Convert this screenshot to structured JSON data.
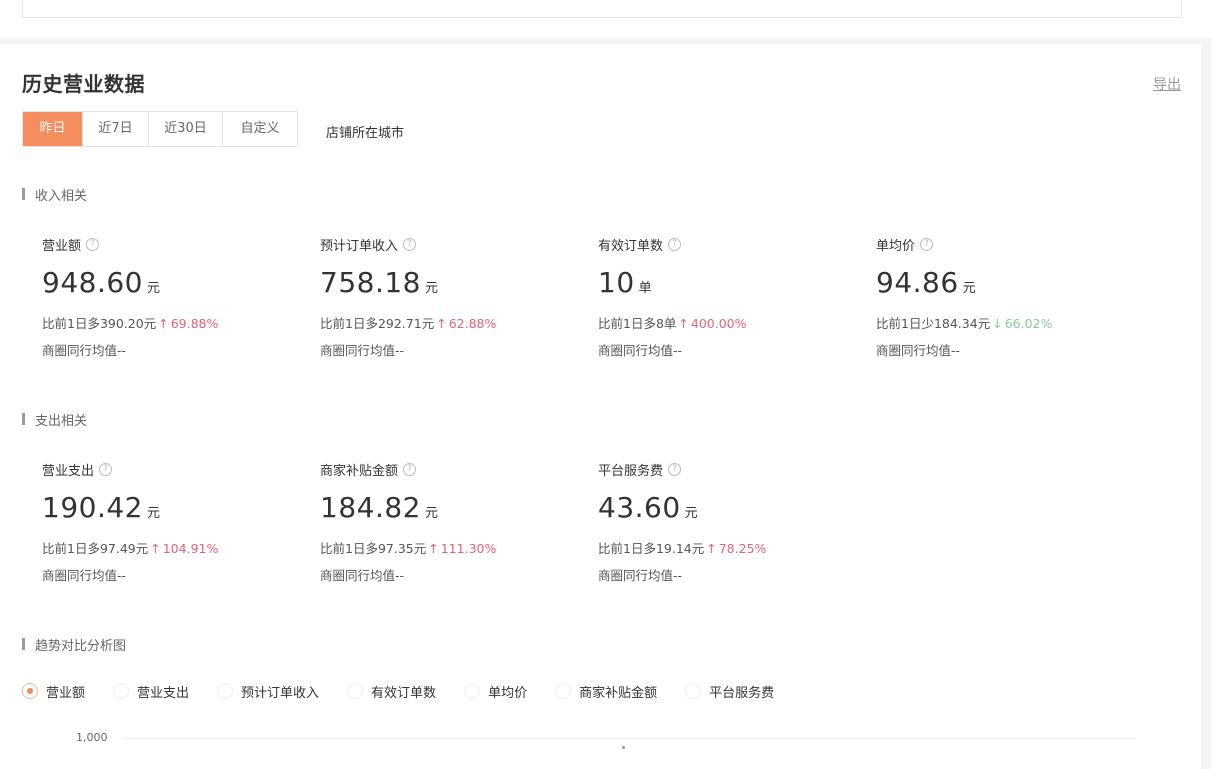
{
  "page": {
    "title": "历史营业数据",
    "export_label": "导出"
  },
  "tabs": [
    {
      "label": "昨日",
      "active": true
    },
    {
      "label": "近7日",
      "active": false
    },
    {
      "label": "近30日",
      "active": false
    },
    {
      "label": "自定义",
      "active": false
    }
  ],
  "city_label": "店铺所在城市",
  "help_glyph": "?",
  "colors": {
    "accent": "#f58d5e",
    "up": "#e0637c",
    "down": "#8dc79c"
  },
  "income_section": {
    "title": "收入相关",
    "metrics": [
      {
        "title": "营业额",
        "value": "948.60",
        "unit": "元",
        "compare": "比前1日多390.20元",
        "direction": "up",
        "arrow": "↑",
        "percent": "69.88%",
        "avg": "商圈同行均值--"
      },
      {
        "title": "预计订单收入",
        "value": "758.18",
        "unit": "元",
        "compare": "比前1日多292.71元",
        "direction": "up",
        "arrow": "↑",
        "percent": "62.88%",
        "avg": "商圈同行均值--"
      },
      {
        "title": "有效订单数",
        "value": "10",
        "unit": "单",
        "compare": "比前1日多8单",
        "direction": "up",
        "arrow": "↑",
        "percent": "400.00%",
        "avg": "商圈同行均值--"
      },
      {
        "title": "单均价",
        "value": "94.86",
        "unit": "元",
        "compare": "比前1日少184.34元",
        "direction": "down",
        "arrow": "↓",
        "percent": "66.02%",
        "avg": "商圈同行均值--"
      }
    ]
  },
  "expense_section": {
    "title": "支出相关",
    "metrics": [
      {
        "title": "营业支出",
        "value": "190.42",
        "unit": "元",
        "compare": "比前1日多97.49元",
        "direction": "up",
        "arrow": "↑",
        "percent": "104.91%",
        "avg": "商圈同行均值--"
      },
      {
        "title": "商家补贴金额",
        "value": "184.82",
        "unit": "元",
        "compare": "比前1日多97.35元",
        "direction": "up",
        "arrow": "↑",
        "percent": "111.30%",
        "avg": "商圈同行均值--"
      },
      {
        "title": "平台服务费",
        "value": "43.60",
        "unit": "元",
        "compare": "比前1日多19.14元",
        "direction": "up",
        "arrow": "↑",
        "percent": "78.25%",
        "avg": "商圈同行均值--"
      }
    ]
  },
  "trend_section": {
    "title": "趋势对比分析图",
    "options": [
      {
        "label": "营业额",
        "checked": true
      },
      {
        "label": "营业支出",
        "checked": false
      },
      {
        "label": "预计订单收入",
        "checked": false
      },
      {
        "label": "有效订单数",
        "checked": false
      },
      {
        "label": "单均价",
        "checked": false
      },
      {
        "label": "商家补贴金额",
        "checked": false
      },
      {
        "label": "平台服务费",
        "checked": false
      }
    ],
    "y_tick": "1,000"
  }
}
